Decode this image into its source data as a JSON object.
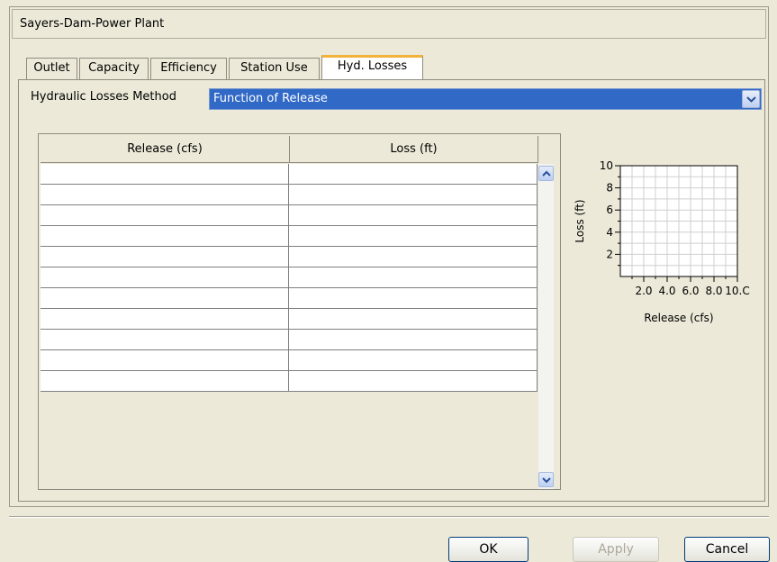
{
  "window": {
    "title": "Sayers-Dam-Power Plant"
  },
  "tabs": [
    {
      "label": "Outlet",
      "active": false
    },
    {
      "label": "Capacity",
      "active": false
    },
    {
      "label": "Efficiency",
      "active": false
    },
    {
      "label": "Station Use",
      "active": false
    },
    {
      "label": "Hyd. Losses",
      "active": true
    }
  ],
  "method": {
    "label": "Hydraulic Losses Method",
    "value": "Function of Release"
  },
  "table": {
    "columns": [
      "Release (cfs)",
      "Loss (ft)"
    ],
    "rows": [
      [
        "",
        ""
      ],
      [
        "",
        ""
      ],
      [
        "",
        ""
      ],
      [
        "",
        ""
      ],
      [
        "",
        ""
      ],
      [
        "",
        ""
      ],
      [
        "",
        ""
      ],
      [
        "",
        ""
      ],
      [
        "",
        ""
      ],
      [
        "",
        ""
      ],
      [
        "",
        ""
      ]
    ]
  },
  "chart_data": {
    "type": "line",
    "title": "",
    "xlabel": "Release (cfs)",
    "ylabel": "Loss (ft)",
    "x_ticks": [
      "2.0",
      "4.0",
      "6.0",
      "8.0",
      "10.C"
    ],
    "y_ticks": [
      "10",
      "8",
      "6",
      "4",
      "2"
    ],
    "xlim": [
      0,
      10
    ],
    "ylim": [
      0,
      10
    ],
    "grid": true,
    "series": []
  },
  "buttons": {
    "ok": "OK",
    "apply": "Apply",
    "cancel": "Cancel"
  },
  "icons": {
    "dropdown": "chevron-down-icon",
    "scroll_up": "chevron-up-icon",
    "scroll_down": "chevron-down-icon"
  },
  "colors": {
    "selection": "#3169c6",
    "active_tab_accent": "#f3b23a"
  }
}
